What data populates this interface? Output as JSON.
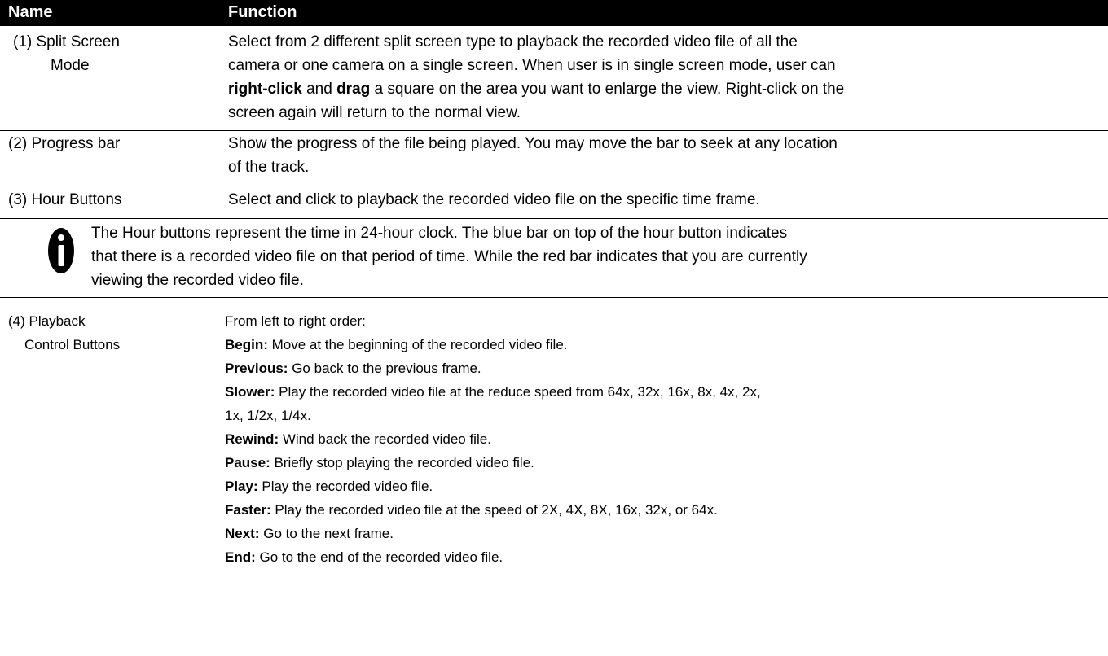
{
  "header": {
    "name": "Name",
    "function": "Function"
  },
  "rows": [
    {
      "name_lines": [
        "(1) Split Screen",
        "Mode"
      ],
      "function_lines": [
        "Select from 2 different split screen type to playback the recorded video file of all the",
        "camera or one camera on a single screen. When user is in single screen mode, user can",
        {
          "b1": "right-click",
          "t1": " and ",
          "b2": "drag",
          "t2": " a square on the area you want to enlarge the view. Right-click on the"
        },
        "screen again will return to the normal view."
      ]
    },
    {
      "name_lines": [
        "(2) Progress bar"
      ],
      "function_lines": [
        "Show the progress of the file being played. You may move the bar to seek at any location",
        "of the track."
      ]
    },
    {
      "name_lines": [
        "(3) Hour Buttons"
      ],
      "function_lines": [
        "Select and click to playback the recorded video file on the specific time frame."
      ]
    }
  ],
  "note": {
    "icon": "info-icon",
    "lines": [
      "The Hour buttons represent the time in 24-hour clock. The blue bar on top of the hour button indicates",
      "that there is a recorded video file on that period of time. While the red bar indicates that you are currently",
      "viewing the recorded video file."
    ]
  },
  "playback": {
    "name_lines": [
      "(4) Playback",
      "Control Buttons"
    ],
    "intro": "From left to right order:",
    "items": [
      {
        "label": "Begin:",
        "text": " Move at the beginning of the recorded video file."
      },
      {
        "label": "Previous:",
        "text": " Go back to the previous frame."
      },
      {
        "label": "Slower:",
        "text": " Play the recorded video file at the reduce speed from 64x, 32x, 16x, 8x, 4x, 2x,"
      },
      {
        "label": "",
        "text": "1x, 1/2x, 1/4x."
      },
      {
        "label": "Rewind:",
        "text": " Wind back the recorded video file."
      },
      {
        "label": "Pause:",
        "text": " Briefly stop playing the recorded video file."
      },
      {
        "label": "Play:",
        "text": " Play the recorded video file."
      },
      {
        "label": "Faster:",
        "text": " Play the recorded video file at the speed of 2X, 4X, 8X, 16x, 32x, or 64x."
      },
      {
        "label": "Next:",
        "text": " Go to the next frame."
      },
      {
        "label": "End:",
        "text": " Go to the end of the recorded video file."
      }
    ]
  }
}
